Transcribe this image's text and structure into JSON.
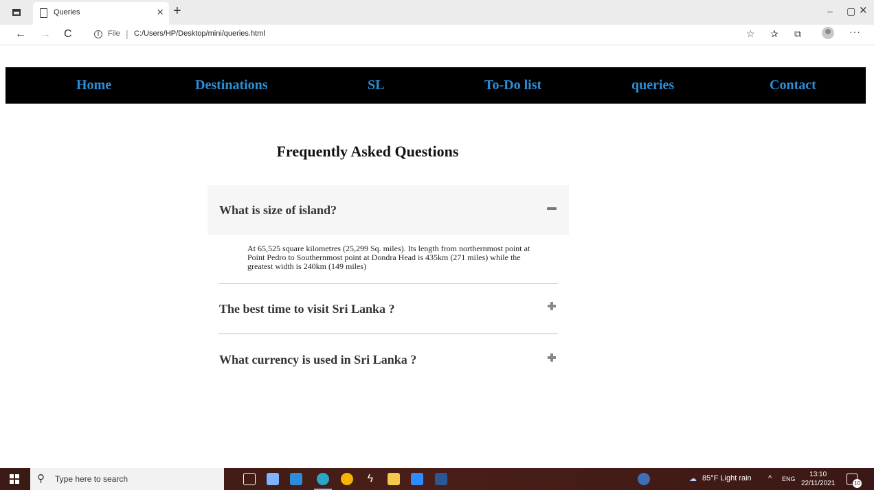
{
  "browser": {
    "tab_title": "Queries",
    "tab_close": "×",
    "new_tab": "+",
    "minimize": "–",
    "maximize": "▢",
    "close": "✕",
    "back": "←",
    "forward": "→",
    "reload": "C",
    "info_glyph": "i",
    "file_label": "File",
    "address_separator": "|",
    "url": "C:/Users/HP/Desktop/mini/queries.html",
    "read_aloud": "☆",
    "favorites": "✰",
    "collections": "⧉",
    "more": "···"
  },
  "nav": {
    "items": [
      "Home",
      "Destinations",
      "SL",
      "To-Do list",
      "queries",
      "Contact"
    ],
    "link_color": "#2b8fd8"
  },
  "faq": {
    "title": "Frequently Asked Questions",
    "items": [
      {
        "question": "What is size of island?",
        "expanded": true,
        "answer": "At 65,525 square kilometres (25,299 Sq. miles). Its length from northernmost point at Point Pedro to Southernmost point at Dondra Head is 435km (271 miles) while the greatest width is 240km (149 miles)"
      },
      {
        "question": "The best time to visit Sri Lanka ?",
        "expanded": false
      },
      {
        "question": "What currency is used in Sri Lanka ?",
        "expanded": false
      }
    ]
  },
  "taskbar": {
    "search_placeholder": "Type here to search",
    "weather": "85°F  Light rain",
    "chevron": "^",
    "lang": "ENG",
    "time": "13:10",
    "date": "22/11/2021",
    "notification_count": "10"
  }
}
